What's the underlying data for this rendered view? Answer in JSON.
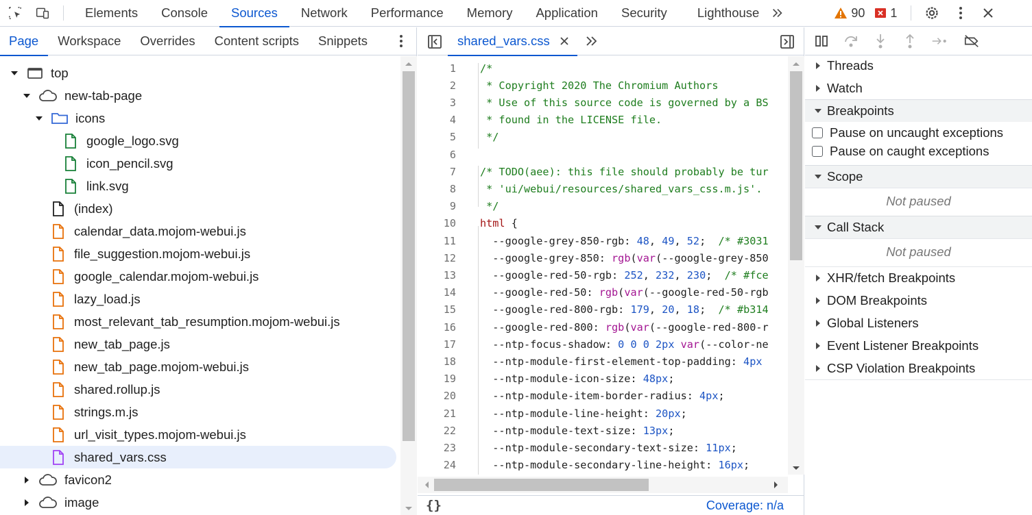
{
  "toolbar": {
    "tabs": [
      "Elements",
      "Console",
      "Sources",
      "Network",
      "Performance",
      "Memory",
      "Application",
      "Security",
      "Lighthouse"
    ],
    "active_tab": "Sources",
    "warnings_count": "90",
    "errors_count": "1"
  },
  "navigator": {
    "tabs": [
      "Page",
      "Workspace",
      "Overrides",
      "Content scripts",
      "Snippets"
    ],
    "active_tab": "Page",
    "tree": [
      {
        "label": "top",
        "icon": "frame-icon",
        "depth": 0,
        "expanded": true
      },
      {
        "label": "new-tab-page",
        "icon": "cloud-icon",
        "depth": 1,
        "expanded": true
      },
      {
        "label": "icons",
        "icon": "folder-icon",
        "depth": 2,
        "expanded": true
      },
      {
        "label": "google_logo.svg",
        "icon": "file-green-icon",
        "depth": 3
      },
      {
        "label": "icon_pencil.svg",
        "icon": "file-green-icon",
        "depth": 3
      },
      {
        "label": "link.svg",
        "icon": "file-green-icon",
        "depth": 3
      },
      {
        "label": "(index)",
        "icon": "file-plain-icon",
        "depth": 2
      },
      {
        "label": "calendar_data.mojom-webui.js",
        "icon": "file-orange-icon",
        "depth": 2
      },
      {
        "label": "file_suggestion.mojom-webui.js",
        "icon": "file-orange-icon",
        "depth": 2
      },
      {
        "label": "google_calendar.mojom-webui.js",
        "icon": "file-orange-icon",
        "depth": 2
      },
      {
        "label": "lazy_load.js",
        "icon": "file-orange-icon",
        "depth": 2
      },
      {
        "label": "most_relevant_tab_resumption.mojom-webui.js",
        "icon": "file-orange-icon",
        "depth": 2
      },
      {
        "label": "new_tab_page.js",
        "icon": "file-orange-icon",
        "depth": 2
      },
      {
        "label": "new_tab_page.mojom-webui.js",
        "icon": "file-orange-icon",
        "depth": 2
      },
      {
        "label": "shared.rollup.js",
        "icon": "file-orange-icon",
        "depth": 2
      },
      {
        "label": "strings.m.js",
        "icon": "file-orange-icon",
        "depth": 2
      },
      {
        "label": "url_visit_types.mojom-webui.js",
        "icon": "file-orange-icon",
        "depth": 2
      },
      {
        "label": "shared_vars.css",
        "icon": "file-purple-icon",
        "depth": 2,
        "selected": true
      },
      {
        "label": "favicon2",
        "icon": "cloud-icon",
        "depth": 1,
        "expanded": false
      },
      {
        "label": "image",
        "icon": "cloud-icon",
        "depth": 1,
        "expanded": false
      }
    ]
  },
  "editor": {
    "file_name": "shared_vars.css",
    "lines": [
      {
        "n": "1",
        "segs": [
          [
            "c-com",
            "/*"
          ]
        ]
      },
      {
        "n": "2",
        "segs": [
          [
            "c-com",
            " * Copyright 2020 The Chromium Authors"
          ]
        ]
      },
      {
        "n": "3",
        "segs": [
          [
            "c-com",
            " * Use of this source code is governed by a BS"
          ]
        ]
      },
      {
        "n": "4",
        "segs": [
          [
            "c-com",
            " * found in the LICENSE file."
          ]
        ]
      },
      {
        "n": "5",
        "segs": [
          [
            "c-com",
            " */"
          ]
        ]
      },
      {
        "n": "6",
        "segs": []
      },
      {
        "n": "7",
        "segs": [
          [
            "c-com",
            "/* TODO(aee): this file should probably be tur"
          ]
        ]
      },
      {
        "n": "8",
        "segs": [
          [
            "c-com",
            " * 'ui/webui/resources/shared_vars_css.m.js'."
          ]
        ]
      },
      {
        "n": "9",
        "segs": [
          [
            "c-com",
            " */"
          ]
        ]
      },
      {
        "n": "10",
        "segs": [
          [
            "c-kw",
            "html"
          ],
          [
            "c-plain",
            " {"
          ]
        ]
      },
      {
        "n": "11",
        "segs": [
          [
            "c-plain",
            "  --google-grey-850-rgb: "
          ],
          [
            "c-num",
            "48"
          ],
          [
            "c-plain",
            ", "
          ],
          [
            "c-num",
            "49"
          ],
          [
            "c-plain",
            ", "
          ],
          [
            "c-num",
            "52"
          ],
          [
            "c-plain",
            ";  "
          ],
          [
            "c-com",
            "/* #3031"
          ]
        ]
      },
      {
        "n": "12",
        "segs": [
          [
            "c-plain",
            "  --google-grey-850: "
          ],
          [
            "c-fn",
            "rgb"
          ],
          [
            "c-plain",
            "("
          ],
          [
            "c-fn",
            "var"
          ],
          [
            "c-plain",
            "(--google-grey-850"
          ]
        ]
      },
      {
        "n": "13",
        "segs": [
          [
            "c-plain",
            "  --google-red-50-rgb: "
          ],
          [
            "c-num",
            "252"
          ],
          [
            "c-plain",
            ", "
          ],
          [
            "c-num",
            "232"
          ],
          [
            "c-plain",
            ", "
          ],
          [
            "c-num",
            "230"
          ],
          [
            "c-plain",
            ";  "
          ],
          [
            "c-com",
            "/* #fce"
          ]
        ]
      },
      {
        "n": "14",
        "segs": [
          [
            "c-plain",
            "  --google-red-50: "
          ],
          [
            "c-fn",
            "rgb"
          ],
          [
            "c-plain",
            "("
          ],
          [
            "c-fn",
            "var"
          ],
          [
            "c-plain",
            "(--google-red-50-rgb"
          ]
        ]
      },
      {
        "n": "15",
        "segs": [
          [
            "c-plain",
            "  --google-red-800-rgb: "
          ],
          [
            "c-num",
            "179"
          ],
          [
            "c-plain",
            ", "
          ],
          [
            "c-num",
            "20"
          ],
          [
            "c-plain",
            ", "
          ],
          [
            "c-num",
            "18"
          ],
          [
            "c-plain",
            ";  "
          ],
          [
            "c-com",
            "/* #b314"
          ]
        ]
      },
      {
        "n": "16",
        "segs": [
          [
            "c-plain",
            "  --google-red-800: "
          ],
          [
            "c-fn",
            "rgb"
          ],
          [
            "c-plain",
            "("
          ],
          [
            "c-fn",
            "var"
          ],
          [
            "c-plain",
            "(--google-red-800-r"
          ]
        ]
      },
      {
        "n": "17",
        "segs": [
          [
            "c-plain",
            "  --ntp-focus-shadow: "
          ],
          [
            "c-num",
            "0 0 0 2px"
          ],
          [
            "c-plain",
            " "
          ],
          [
            "c-fn",
            "var"
          ],
          [
            "c-plain",
            "(--color-ne"
          ]
        ]
      },
      {
        "n": "18",
        "segs": [
          [
            "c-plain",
            "  --ntp-module-first-element-top-padding: "
          ],
          [
            "c-num",
            "4px"
          ]
        ]
      },
      {
        "n": "19",
        "segs": [
          [
            "c-plain",
            "  --ntp-module-icon-size: "
          ],
          [
            "c-num",
            "48px"
          ],
          [
            "c-plain",
            ";"
          ]
        ]
      },
      {
        "n": "20",
        "segs": [
          [
            "c-plain",
            "  --ntp-module-item-border-radius: "
          ],
          [
            "c-num",
            "4px"
          ],
          [
            "c-plain",
            ";"
          ]
        ]
      },
      {
        "n": "21",
        "segs": [
          [
            "c-plain",
            "  --ntp-module-line-height: "
          ],
          [
            "c-num",
            "20px"
          ],
          [
            "c-plain",
            ";"
          ]
        ]
      },
      {
        "n": "22",
        "segs": [
          [
            "c-plain",
            "  --ntp-module-text-size: "
          ],
          [
            "c-num",
            "13px"
          ],
          [
            "c-plain",
            ";"
          ]
        ]
      },
      {
        "n": "23",
        "segs": [
          [
            "c-plain",
            "  --ntp-module-secondary-text-size: "
          ],
          [
            "c-num",
            "11px"
          ],
          [
            "c-plain",
            ";"
          ]
        ]
      },
      {
        "n": "24",
        "segs": [
          [
            "c-plain",
            "  --ntp-module-secondary-line-height: "
          ],
          [
            "c-num",
            "16px"
          ],
          [
            "c-plain",
            ";"
          ]
        ]
      }
    ],
    "status_left": "{}",
    "coverage": "Coverage: n/a"
  },
  "debugger": {
    "threads": "Threads",
    "watch": "Watch",
    "breakpoints": "Breakpoints",
    "pause_uncaught": "Pause on uncaught exceptions",
    "pause_caught": "Pause on caught exceptions",
    "scope": "Scope",
    "scope_status": "Not paused",
    "call_stack": "Call Stack",
    "callstack_status": "Not paused",
    "more_sections": [
      "XHR/fetch Breakpoints",
      "DOM Breakpoints",
      "Global Listeners",
      "Event Listener Breakpoints",
      "CSP Violation Breakpoints"
    ]
  },
  "colors": {
    "accent": "#0b57d0",
    "warning": "#e37400",
    "error": "#d93025"
  }
}
